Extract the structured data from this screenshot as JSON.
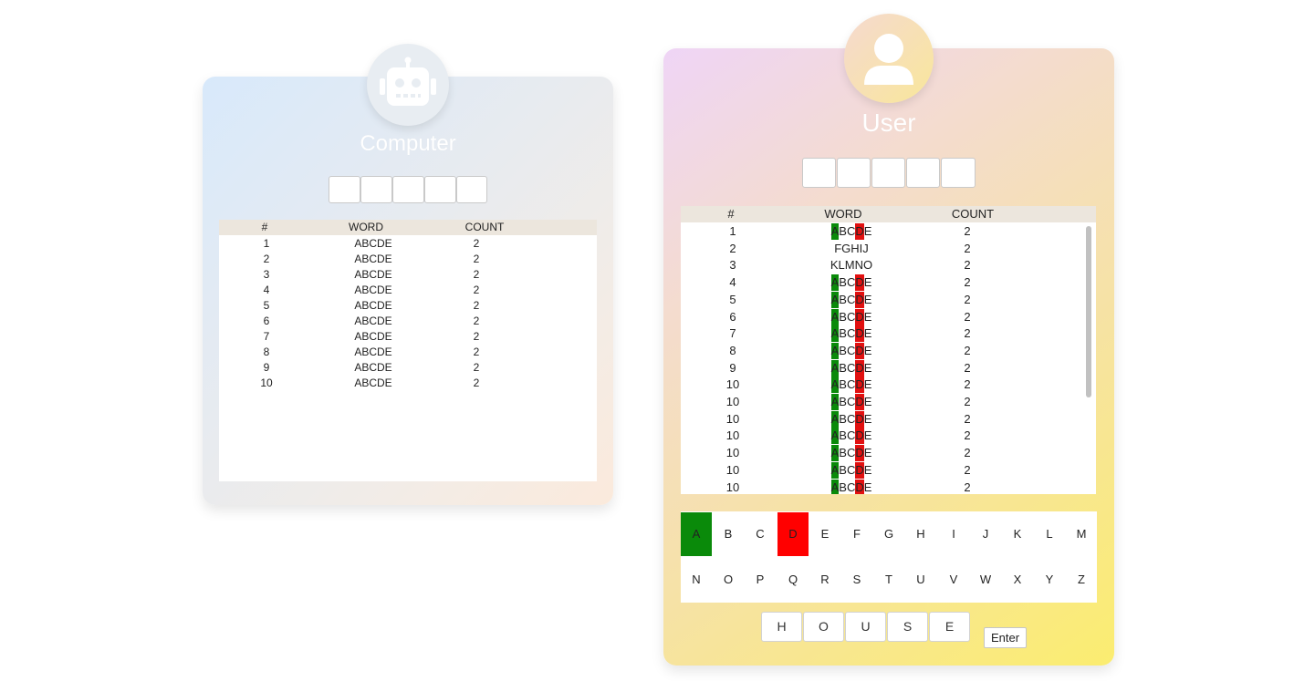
{
  "computer": {
    "title": "Computer",
    "icon": "robot-icon",
    "table": {
      "headers": [
        "#",
        "WORD",
        "COUNT"
      ],
      "rows": [
        {
          "num": "1",
          "word": "ABCDE",
          "count": "2"
        },
        {
          "num": "2",
          "word": "ABCDE",
          "count": "2"
        },
        {
          "num": "3",
          "word": "ABCDE",
          "count": "2"
        },
        {
          "num": "4",
          "word": "ABCDE",
          "count": "2"
        },
        {
          "num": "5",
          "word": "ABCDE",
          "count": "2"
        },
        {
          "num": "6",
          "word": "ABCDE",
          "count": "2"
        },
        {
          "num": "7",
          "word": "ABCDE",
          "count": "2"
        },
        {
          "num": "8",
          "word": "ABCDE",
          "count": "2"
        },
        {
          "num": "9",
          "word": "ABCDE",
          "count": "2"
        },
        {
          "num": "10",
          "word": "ABCDE",
          "count": "2"
        }
      ]
    }
  },
  "user": {
    "title": "User",
    "icon": "user-icon",
    "table": {
      "headers": [
        "#",
        "WORD",
        "COUNT"
      ],
      "rows": [
        {
          "num": "1",
          "word": "ABCDE",
          "count": "2",
          "marks": {
            "0": "green",
            "3": "red"
          }
        },
        {
          "num": "2",
          "word": "FGHIJ",
          "count": "2",
          "marks": {}
        },
        {
          "num": "3",
          "word": "KLMNO",
          "count": "2",
          "marks": {}
        },
        {
          "num": "4",
          "word": "ABCDE",
          "count": "2",
          "marks": {
            "0": "green",
            "3": "red"
          }
        },
        {
          "num": "5",
          "word": "ABCDE",
          "count": "2",
          "marks": {
            "0": "green",
            "3": "red"
          }
        },
        {
          "num": "6",
          "word": "ABCDE",
          "count": "2",
          "marks": {
            "0": "green",
            "3": "red"
          }
        },
        {
          "num": "7",
          "word": "ABCDE",
          "count": "2",
          "marks": {
            "0": "green",
            "3": "red"
          }
        },
        {
          "num": "8",
          "word": "ABCDE",
          "count": "2",
          "marks": {
            "0": "green",
            "3": "red"
          }
        },
        {
          "num": "9",
          "word": "ABCDE",
          "count": "2",
          "marks": {
            "0": "green",
            "3": "red"
          }
        },
        {
          "num": "10",
          "word": "ABCDE",
          "count": "2",
          "marks": {
            "0": "green",
            "3": "red"
          }
        },
        {
          "num": "10",
          "word": "ABCDE",
          "count": "2",
          "marks": {
            "0": "green",
            "3": "red"
          }
        },
        {
          "num": "10",
          "word": "ABCDE",
          "count": "2",
          "marks": {
            "0": "green",
            "3": "red"
          }
        },
        {
          "num": "10",
          "word": "ABCDE",
          "count": "2",
          "marks": {
            "0": "green",
            "3": "red"
          }
        },
        {
          "num": "10",
          "word": "ABCDE",
          "count": "2",
          "marks": {
            "0": "green",
            "3": "red"
          }
        },
        {
          "num": "10",
          "word": "ABCDE",
          "count": "2",
          "marks": {
            "0": "green",
            "3": "red"
          }
        },
        {
          "num": "10",
          "word": "ABCDE",
          "count": "2",
          "marks": {
            "0": "green",
            "3": "red"
          }
        }
      ]
    },
    "keyboard": {
      "row1": [
        "A",
        "B",
        "C",
        "D",
        "E",
        "F",
        "G",
        "H",
        "I",
        "J",
        "K",
        "L",
        "M"
      ],
      "row2": [
        "N",
        "O",
        "P",
        "Q",
        "R",
        "S",
        "T",
        "U",
        "V",
        "W",
        "X",
        "Y",
        "Z"
      ],
      "states": {
        "A": "green",
        "D": "red"
      }
    },
    "current_input": [
      "H",
      "O",
      "U",
      "S",
      "E"
    ],
    "enter_label": "Enter"
  },
  "colors": {
    "correct": "#0a8a0a",
    "wrong": "#e11010",
    "key_wrong": "#ff0000"
  }
}
